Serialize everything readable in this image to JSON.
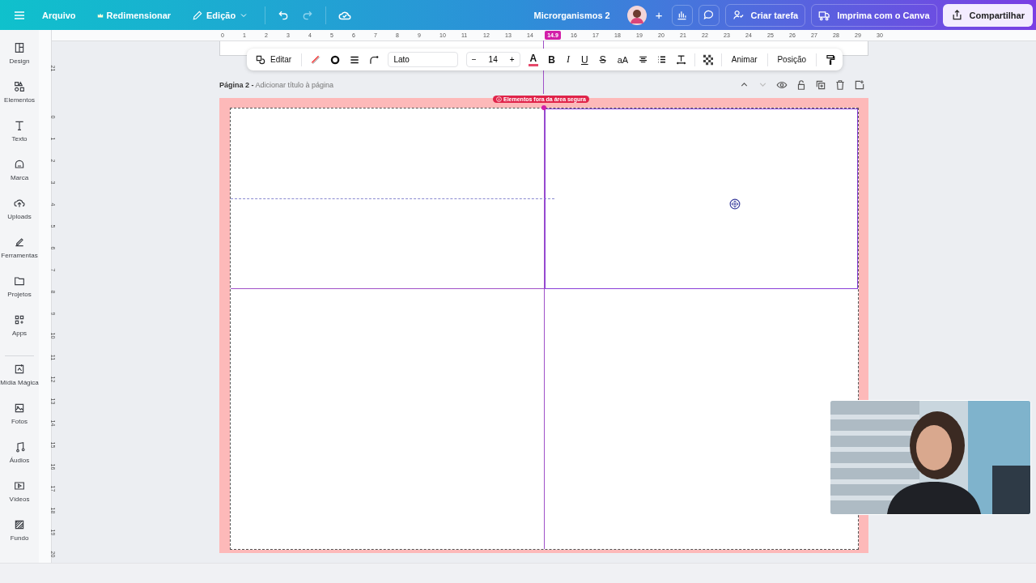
{
  "top_bar": {
    "menu": [
      {
        "label": "Arquivo"
      },
      {
        "label": "Redimensionar"
      },
      {
        "label": "Edição"
      }
    ],
    "title": "Microrganismos 2",
    "add": "+",
    "buttons": [
      {
        "label": "Criar tarefa"
      },
      {
        "label": "Imprima com o Canva"
      },
      {
        "label": "Compartilhar"
      }
    ]
  },
  "sidebar": {
    "items": [
      {
        "label": "Design"
      },
      {
        "label": "Elementos"
      },
      {
        "label": "Texto"
      },
      {
        "label": "Marca"
      },
      {
        "label": "Uploads"
      },
      {
        "label": "Ferramentas"
      },
      {
        "label": "Projetos"
      },
      {
        "label": "Apps"
      },
      {
        "label": "Mídia Mágica"
      },
      {
        "label": "Fotos"
      },
      {
        "label": "Áudios"
      },
      {
        "label": "Vídeos"
      },
      {
        "label": "Fundo"
      }
    ]
  },
  "horizontal_ruler": [
    {
      "label": "0",
      "selected": false
    },
    {
      "label": "1",
      "selected": false
    },
    {
      "label": "2",
      "selected": false
    },
    {
      "label": "3",
      "selected": false
    },
    {
      "label": "4",
      "selected": false
    },
    {
      "label": "5",
      "selected": false
    },
    {
      "label": "6",
      "selected": false
    },
    {
      "label": "7",
      "selected": false
    },
    {
      "label": "8",
      "selected": false
    },
    {
      "label": "9",
      "selected": false
    },
    {
      "label": "10",
      "selected": false
    },
    {
      "label": "11",
      "selected": false
    },
    {
      "label": "12",
      "selected": false
    },
    {
      "label": "13",
      "selected": false
    },
    {
      "label": "14",
      "selected": false
    },
    {
      "label": "14.9",
      "selected": true
    },
    {
      "label": "16",
      "selected": false
    },
    {
      "label": "17",
      "selected": false
    },
    {
      "label": "18",
      "selected": false
    },
    {
      "label": "19",
      "selected": false
    },
    {
      "label": "20",
      "selected": false
    },
    {
      "label": "21",
      "selected": false
    },
    {
      "label": "22",
      "selected": false
    },
    {
      "label": "23",
      "selected": false
    },
    {
      "label": "24",
      "selected": false
    },
    {
      "label": "25",
      "selected": false
    },
    {
      "label": "26",
      "selected": false
    },
    {
      "label": "27",
      "selected": false
    },
    {
      "label": "28",
      "selected": false
    },
    {
      "label": "29",
      "selected": false
    },
    {
      "label": "30",
      "selected": false
    }
  ],
  "vertical_ruler": {
    "previous_page": [
      "21"
    ],
    "page": [
      "0",
      "1",
      "2",
      "3",
      "4",
      "5",
      "6",
      "7",
      "8",
      "9",
      "10",
      "11",
      "12",
      "13",
      "14",
      "15",
      "16",
      "17",
      "18",
      "19",
      "20"
    ]
  },
  "toolbar": {
    "edit": "Editar",
    "font": "Lato",
    "size_minus": "−",
    "font_size": "14",
    "size_plus": "+",
    "text_color": "A",
    "format": [
      "B",
      "I",
      "U",
      "S",
      "aA"
    ],
    "animate": "Animar",
    "position": "Posição"
  },
  "page": {
    "label": "Página 2 -",
    "title_placeholder": "Adicionar título à página",
    "warning": "Elementos fora da área segura"
  }
}
